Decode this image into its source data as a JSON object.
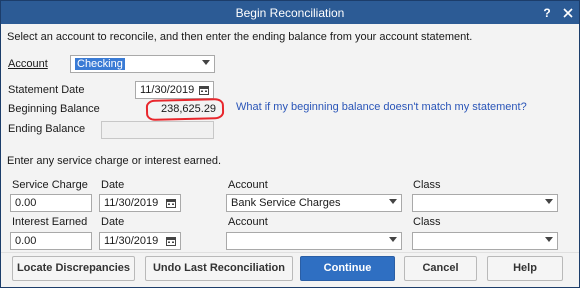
{
  "window": {
    "title": "Begin Reconciliation",
    "help_icon": "question-mark",
    "close_icon": "x"
  },
  "intro_text": "Select an account to reconcile, and then enter the ending balance from your account statement.",
  "account": {
    "label": "Account",
    "value": "Checking"
  },
  "statement_date": {
    "label": "Statement Date",
    "value": "11/30/2019"
  },
  "beginning_balance": {
    "label": "Beginning Balance",
    "value": "238,625.29",
    "help_link": "What if my beginning balance doesn't match my statement?"
  },
  "ending_balance": {
    "label": "Ending Balance",
    "value": ""
  },
  "section_text": "Enter any service charge or interest earned.",
  "service_charge": {
    "amount_label": "Service Charge",
    "amount_value": "0.00",
    "date_label": "Date",
    "date_value": "11/30/2019",
    "account_label": "Account",
    "account_value": "Bank Service Charges",
    "class_label": "Class",
    "class_value": ""
  },
  "interest_earned": {
    "amount_label": "Interest Earned",
    "amount_value": "0.00",
    "date_label": "Date",
    "date_value": "11/30/2019",
    "account_label": "Account",
    "account_value": "",
    "class_label": "Class",
    "class_value": ""
  },
  "buttons": {
    "locate": "Locate Discrepancies",
    "undo": "Undo Last Reconciliation",
    "continue": "Continue",
    "cancel": "Cancel",
    "help": "Help"
  },
  "colors": {
    "title_bar": "#2c5b95",
    "primary_button": "#2f6fc2",
    "link": "#2a55b8",
    "highlight_annotation": "#e8262c"
  }
}
